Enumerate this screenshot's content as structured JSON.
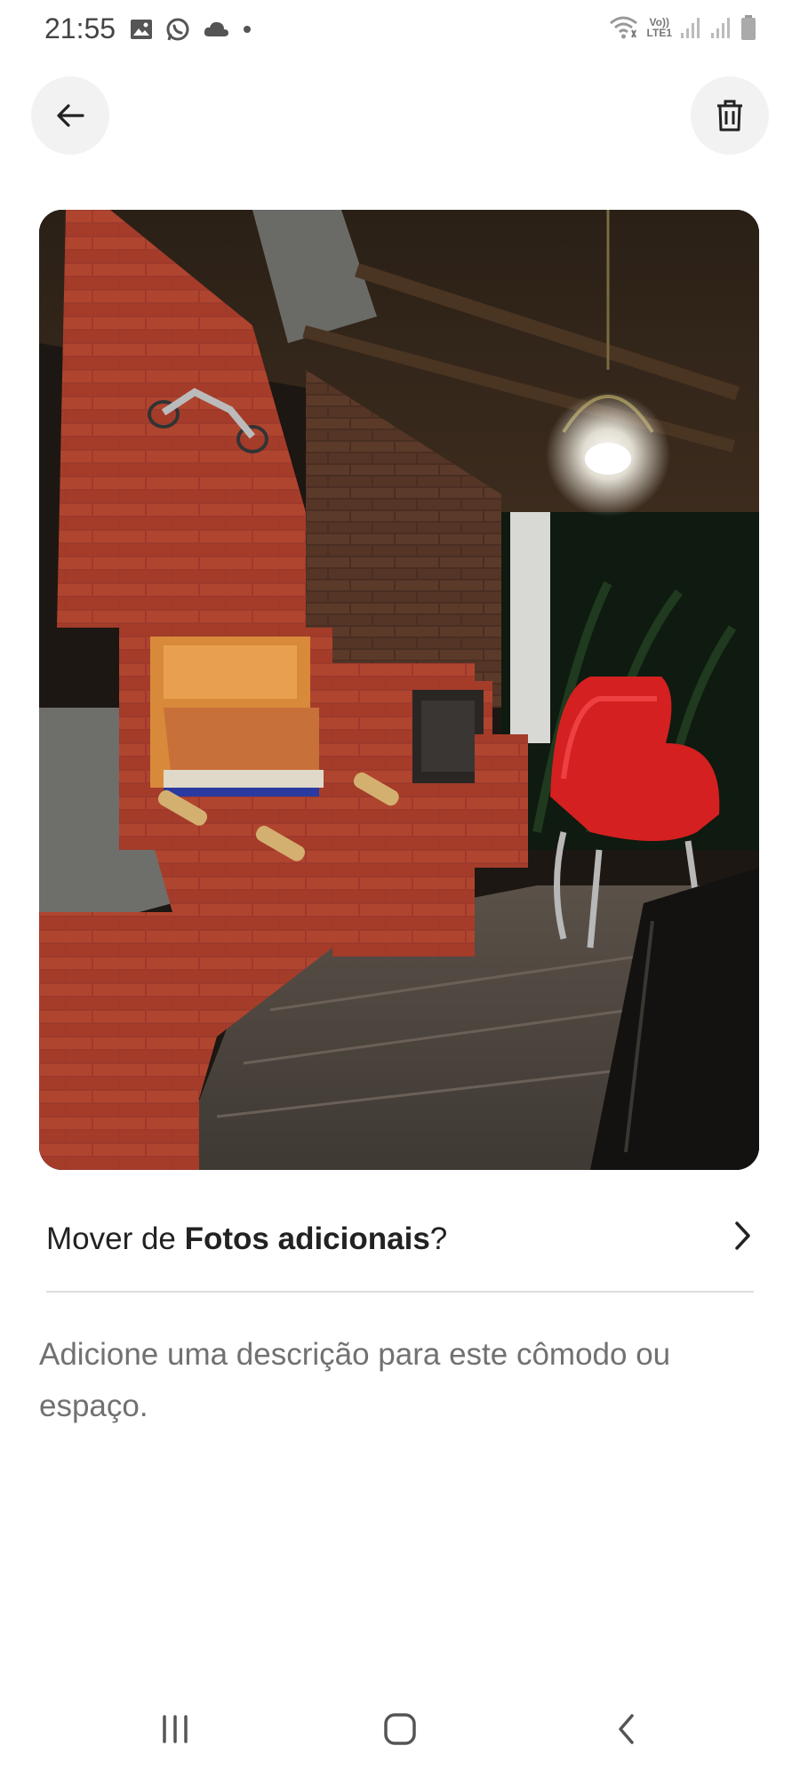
{
  "status_bar": {
    "time": "21:55",
    "left_icons": [
      "image-icon",
      "whatsapp-icon",
      "cloud-icon",
      "dot-icon"
    ],
    "right_icons": [
      "wifi-icon",
      "volte-lte-icon",
      "signal-icon",
      "signal-icon",
      "battery-icon"
    ],
    "volte_label_top": "Vo))",
    "volte_label_bottom": "LTE1"
  },
  "header": {
    "back_icon": "arrow-left-icon",
    "delete_icon": "trash-icon"
  },
  "photo": {
    "subject": "brick barbecue grill area with red chairs"
  },
  "move_row": {
    "prefix": "Mover de ",
    "album": "Fotos adicionais",
    "suffix": "?",
    "icon": "chevron-right-icon"
  },
  "description": {
    "placeholder": "Adicione uma descrição para este cômodo ou espaço."
  },
  "nav_bar": {
    "icons": [
      "recent-apps-icon",
      "home-icon",
      "back-icon"
    ]
  },
  "colors": {
    "text_primary": "#222222",
    "text_secondary": "#717171",
    "button_bg": "#f2f2f2",
    "divider": "#dddddd"
  }
}
